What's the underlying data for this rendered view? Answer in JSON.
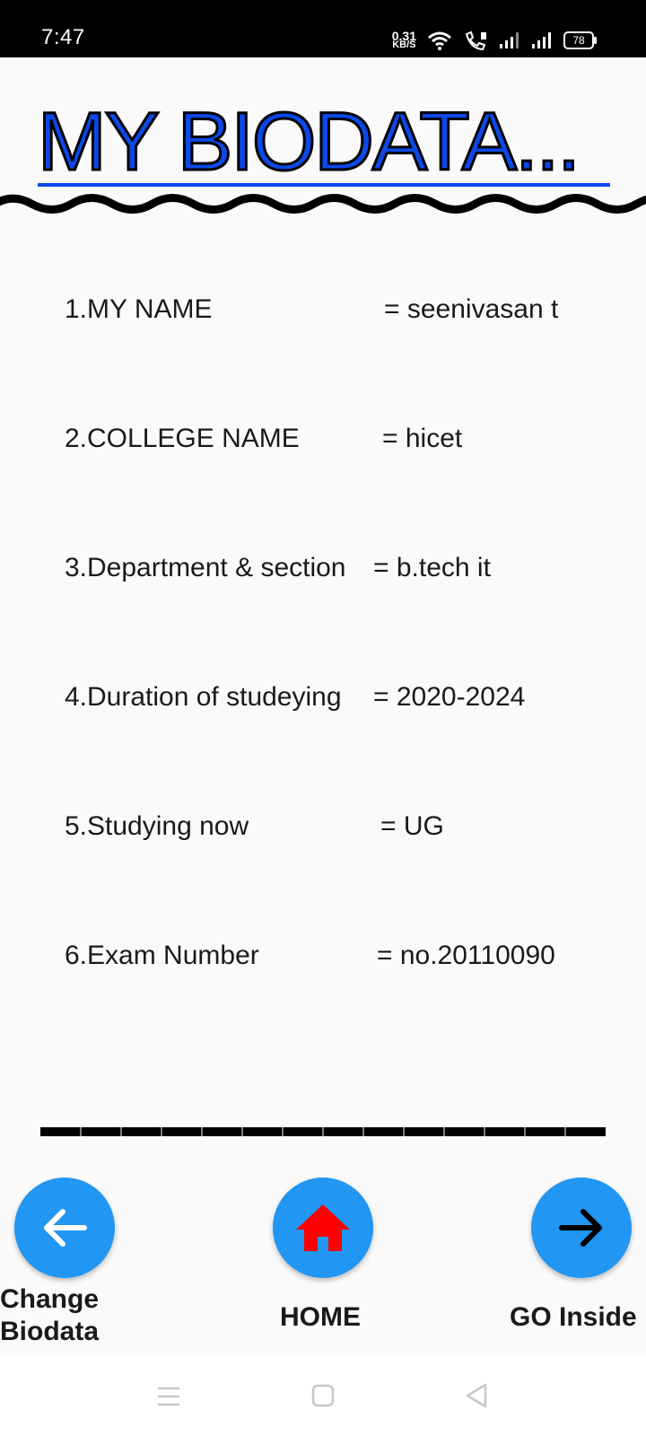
{
  "status_bar": {
    "time": "7:47",
    "net_speed_value": "0.31",
    "net_speed_unit": "KB/S",
    "battery": "78"
  },
  "title": "MY BIODATA...",
  "rows": [
    {
      "label": "1.MY NAME",
      "value": "=  seenivasan t"
    },
    {
      "label": "2.COLLEGE NAME",
      "value": "=   hicet"
    },
    {
      "label": "3.Department & section",
      "value": "=  b.tech it"
    },
    {
      "label": "4.Duration of studeying",
      "value": "=  2020-2024"
    },
    {
      "label": "5.Studying now",
      "value": "=  UG"
    },
    {
      "label": "6.Exam Number",
      "value": "= no.20110090"
    }
  ],
  "nav": {
    "change_line1": "Change",
    "change_line2": "Biodata",
    "home": "HOME",
    "go_inside": "GO Inside"
  },
  "colors": {
    "title_blue": "#0b49e8",
    "button_blue": "#2196f3",
    "home_icon_red": "#ff0000"
  }
}
